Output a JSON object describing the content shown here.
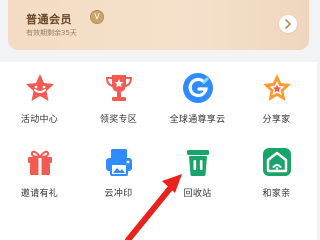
{
  "member": {
    "title": "普通会员",
    "subtitle": "有效期剩余35天",
    "badge_symbol": "V"
  },
  "grid": [
    {
      "label": "活动中心",
      "icon": "activity-center-icon"
    },
    {
      "label": "领奖专区",
      "icon": "trophy-icon"
    },
    {
      "label": "全球通尊享云",
      "icon": "global-cloud-icon"
    },
    {
      "label": "分享家",
      "icon": "share-star-icon"
    },
    {
      "label": "邀请有礼",
      "icon": "gift-icon"
    },
    {
      "label": "云冲印",
      "icon": "photo-print-icon"
    },
    {
      "label": "回收站",
      "icon": "recycle-bin-icon"
    },
    {
      "label": "和家亲",
      "icon": "family-home-icon"
    }
  ],
  "colors": {
    "red": "#f25a52",
    "blue": "#2f8cff",
    "green": "#19a46a",
    "orange": "#ff9a2f",
    "arrow": "#e8221c"
  }
}
